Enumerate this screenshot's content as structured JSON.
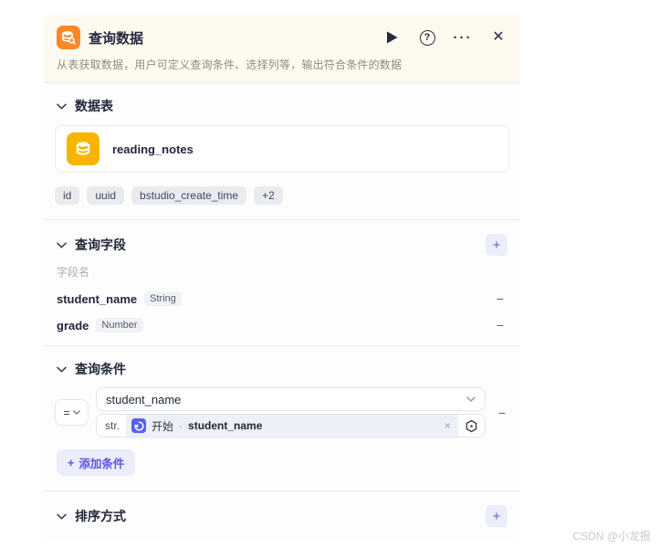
{
  "header": {
    "title": "查询数据",
    "subtitle": "从表获取数据，用户可定义查询条件、选择列等，输出符合条件的数据"
  },
  "icons": {
    "help": "?",
    "more": "···",
    "close": "✕",
    "plus": "+",
    "minus": "−",
    "clear": "×",
    "operator_equals": "="
  },
  "sections": {
    "table": {
      "label": "数据表",
      "table_name": "reading_notes",
      "chips": [
        "id",
        "uuid",
        "bstudio_create_time",
        "+2"
      ]
    },
    "fields": {
      "label": "查询字段",
      "column_header": "字段名",
      "rows": [
        {
          "name": "student_name",
          "type": "String"
        },
        {
          "name": "grade",
          "type": "Number"
        }
      ]
    },
    "conditions": {
      "label": "查询条件",
      "operator": "=",
      "field_select_value": "student_name",
      "value_type_prefix": "str.",
      "value_ref_source": "开始",
      "value_ref_separator": "·",
      "value_ref_field": "student_name",
      "add_button_label": "添加条件"
    },
    "sort": {
      "label": "排序方式"
    }
  },
  "colors": {
    "node_icon_orange": "#ff8727",
    "table_icon_amber": "#f7b500",
    "accent_purple": "#5b53e6",
    "ref_token_blue": "#585ff0",
    "header_cream_bg": "#fefaf0"
  },
  "watermark": "CSDN @小龙报"
}
